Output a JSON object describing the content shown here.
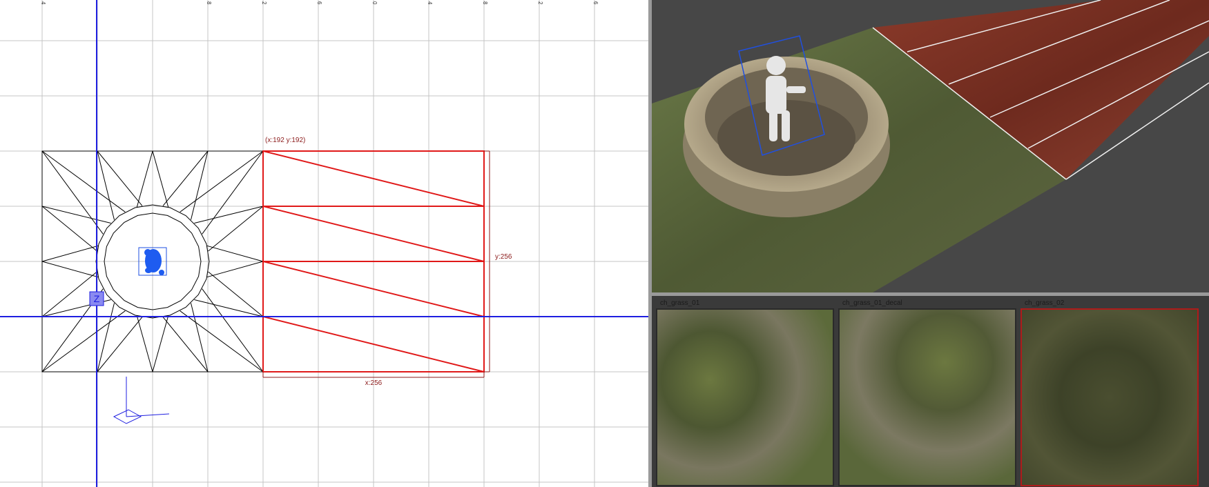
{
  "grid_view": {
    "ruler_ticks": [
      "4",
      "",
      "",
      "8",
      "2",
      "6",
      "0",
      "4",
      "8",
      "2",
      "6"
    ],
    "origin_label": "(x:192  y:192)",
    "height_label": "y:256",
    "width_label": "x:256",
    "axis_letter": "Z",
    "colors": {
      "grid": "#c0c0c0",
      "axis": "#1e1ee0",
      "selection": "#e01818",
      "mesh": "#000000",
      "label": "#8b1a1a"
    }
  },
  "texture_browser": {
    "tiles": [
      {
        "name": "ch_grass_01",
        "selected": false
      },
      {
        "name": "ch_grass_01_decal",
        "selected": false
      },
      {
        "name": "ch_grass_02",
        "selected": true
      }
    ]
  }
}
